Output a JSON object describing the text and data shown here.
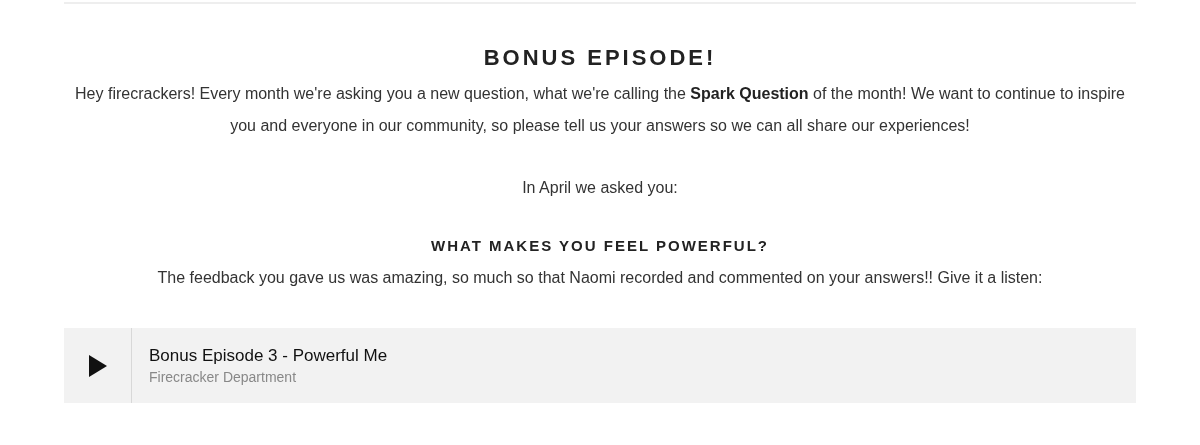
{
  "heading": "BONUS EPISODE!",
  "intro": "Hey firecrackers! Every month we're asking you a new question, what we're calling the **Spark Question** of the month! We want to continue to inspire you and everyone in our community, so please tell us your answers so we can all share our experiences!",
  "lead": "In April we asked you:",
  "question": "WHAT MAKES YOU FEEL POWERFUL?",
  "followup": "The feedback you gave us was amazing, so much so that Naomi recorded and commented on your answers!! Give it a listen:",
  "player": {
    "title": "Bonus Episode 3 - Powerful Me",
    "artist": "Firecracker Department"
  }
}
